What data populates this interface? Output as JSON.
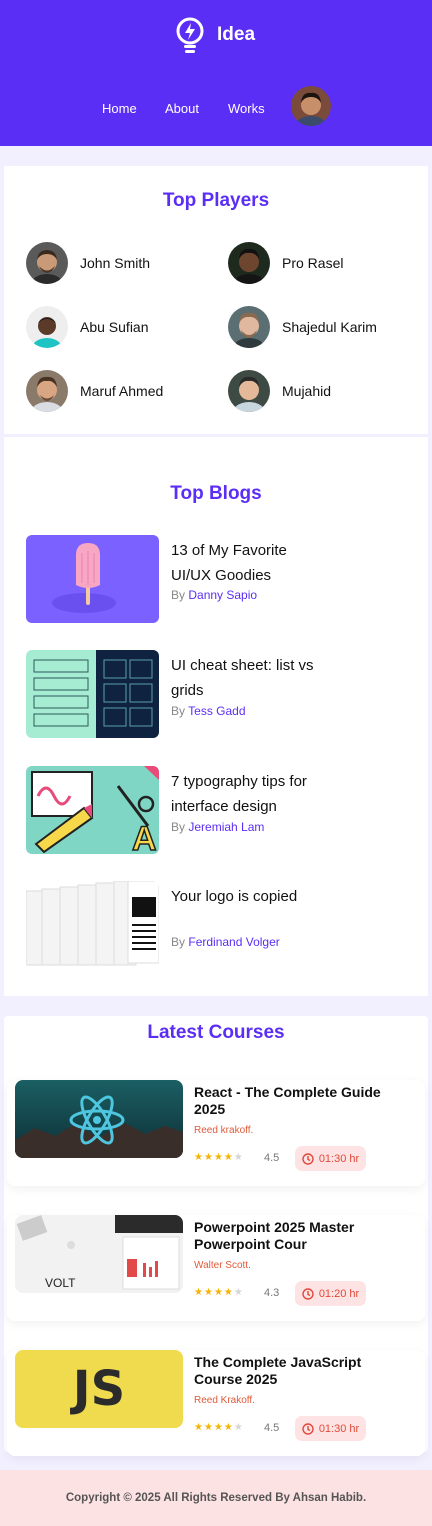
{
  "brand": {
    "name": "Idea",
    "icon": "lightbulb-icon"
  },
  "nav": {
    "items": [
      {
        "label": "Home"
      },
      {
        "label": "About"
      },
      {
        "label": "Works"
      }
    ]
  },
  "players": {
    "title": "Top Players",
    "items": [
      {
        "name": "John Smith"
      },
      {
        "name": "Pro Rasel"
      },
      {
        "name": "Abu Sufian"
      },
      {
        "name": "Shajedul Karim"
      },
      {
        "name": "Maruf Ahmed"
      },
      {
        "name": "Mujahid"
      }
    ]
  },
  "blogs": {
    "title": "Top Blogs",
    "by_label": "By",
    "items": [
      {
        "title": "13 of My Favorite UI/UX Goodies",
        "author": "Danny Sapio"
      },
      {
        "title": "UI cheat sheet: list vs grids",
        "author": "Tess Gadd"
      },
      {
        "title": "7 typography tips for interface design",
        "author": "Jeremiah Lam"
      },
      {
        "title": "Your logo is copied",
        "author": "Ferdinand Volger"
      }
    ]
  },
  "courses": {
    "title": "Latest Courses",
    "items": [
      {
        "title": "React - The Complete Guide 2025",
        "instructor": "Reed krakoff.",
        "rating": "4.5",
        "stars": 4,
        "duration": "01:30 hr"
      },
      {
        "title": "Powerpoint 2025 Master Powerpoint Cour",
        "instructor": "Walter Scott.",
        "rating": "4.3",
        "stars": 4,
        "duration": "01:20 hr",
        "thumb_text": "VOLT"
      },
      {
        "title": "The Complete JavaScript Course 2025",
        "instructor": "Reed Krakoff.",
        "rating": "4.5",
        "stars": 4,
        "duration": "01:30 hr",
        "thumb_text": "JS"
      }
    ]
  },
  "footer": {
    "text": "Copyright © 2025 All Rights Reserved By Ahsan Habib."
  },
  "colors": {
    "brand": "#5b2ef5",
    "accent_red": "#e04a3a",
    "star": "#f4b400",
    "footer_bg": "#fde2e4"
  }
}
